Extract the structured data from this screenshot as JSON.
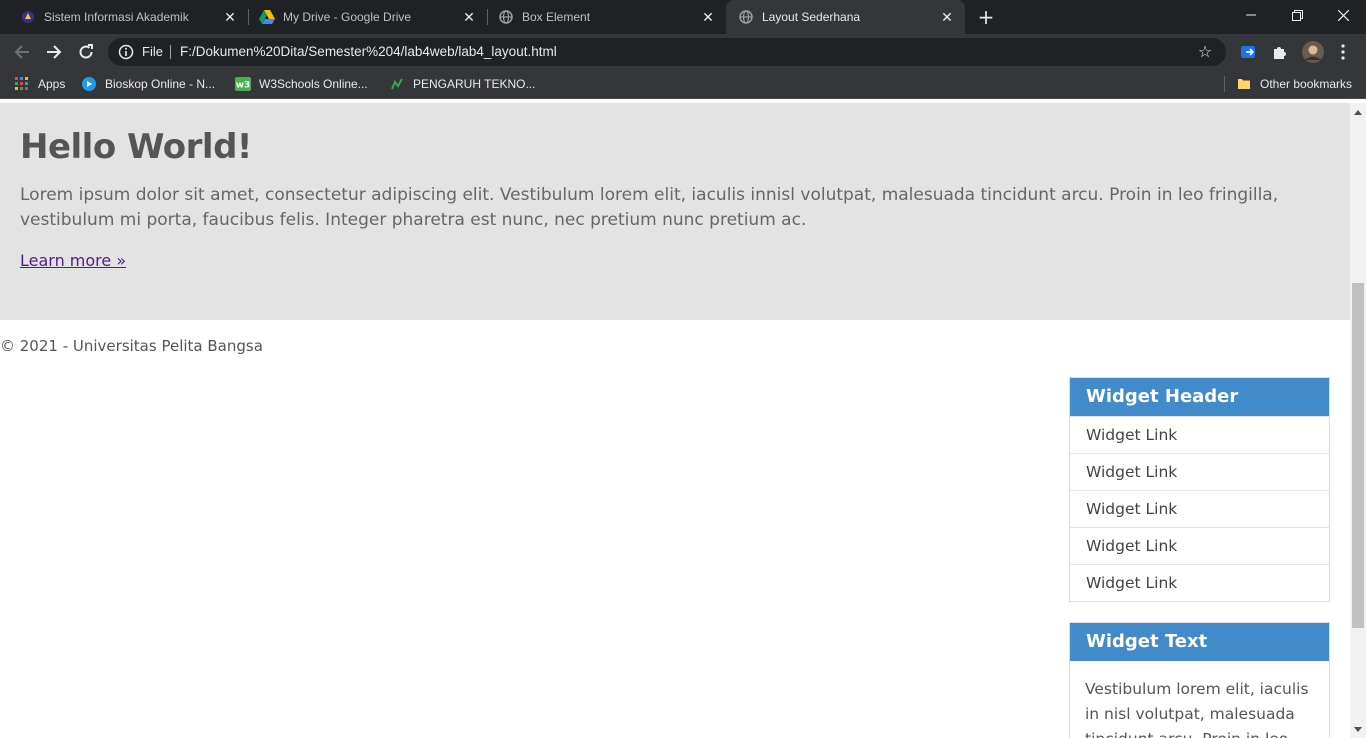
{
  "browser": {
    "tabs": [
      {
        "title": "Sistem Informasi Akademik",
        "icon": "academic-favicon"
      },
      {
        "title": "My Drive - Google Drive",
        "icon": "google-drive-favicon"
      },
      {
        "title": "Box Element",
        "icon": "globe-favicon"
      },
      {
        "title": "Layout Sederhana",
        "icon": "globe-favicon",
        "active": true
      }
    ],
    "address": {
      "scheme_label": "File",
      "url": "F:/Dokumen%20Dita/Semester%204/lab4web/lab4_layout.html"
    },
    "bookmarks": [
      {
        "label": "Apps",
        "icon": "apps-grid-icon"
      },
      {
        "label": "Bioskop Online - N...",
        "icon": "play-favicon"
      },
      {
        "label": "W3Schools Online...",
        "icon": "w3schools-favicon"
      },
      {
        "label": "PENGARUH TEKNO...",
        "icon": "site-favicon"
      }
    ],
    "other_bookmarks": "Other bookmarks"
  },
  "page": {
    "hero": {
      "title": "Hello World!",
      "text": "Lorem ipsum dolor sit amet, consectetur adipiscing elit. Vestibulum lorem elit, iaculis innisl volutpat, malesuada tincidunt arcu. Proin in leo fringilla, vestibulum mi porta, faucibus felis. Integer pharetra est nunc, nec pretium nunc pretium ac.",
      "link": "Learn more »"
    },
    "footer": "© 2021 - Universitas Pelita Bangsa",
    "widget1": {
      "header": "Widget Header",
      "links": [
        "Widget Link",
        "Widget Link",
        "Widget Link",
        "Widget Link",
        "Widget Link"
      ]
    },
    "widget2": {
      "header": "Widget Text",
      "text": "Vestibulum lorem elit, iaculis in nisl volutpat, malesuada tincidunt arcu. Proin in leo"
    }
  },
  "colors": {
    "hero_bg": "#e3e3e3",
    "widget_header": "#428bca",
    "visited_link": "#551a8b"
  }
}
